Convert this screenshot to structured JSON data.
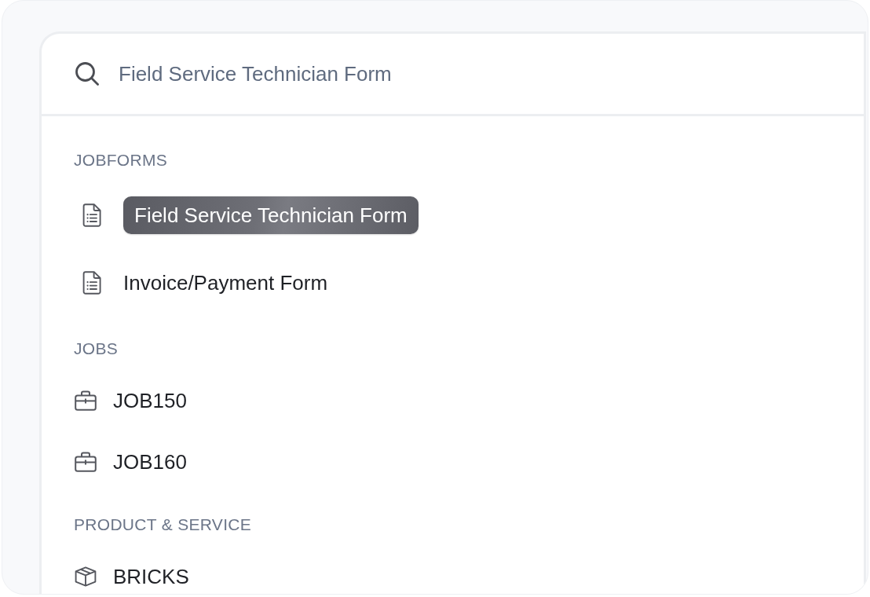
{
  "search": {
    "value": "Field Service Technician Form"
  },
  "sections": [
    {
      "title": "JOBFORMS",
      "items": [
        {
          "label": "Field Service Technician Form",
          "kind": "form",
          "selected": true
        },
        {
          "label": "Invoice/Payment Form",
          "kind": "form",
          "selected": false
        }
      ]
    },
    {
      "title": "JOBS",
      "items": [
        {
          "label": "JOB150",
          "kind": "job",
          "selected": false
        },
        {
          "label": "JOB160",
          "kind": "job",
          "selected": false
        }
      ]
    },
    {
      "title": "PRODUCT & SERVICE",
      "items": [
        {
          "label": "BRICKS",
          "kind": "product",
          "selected": false
        }
      ]
    }
  ]
}
